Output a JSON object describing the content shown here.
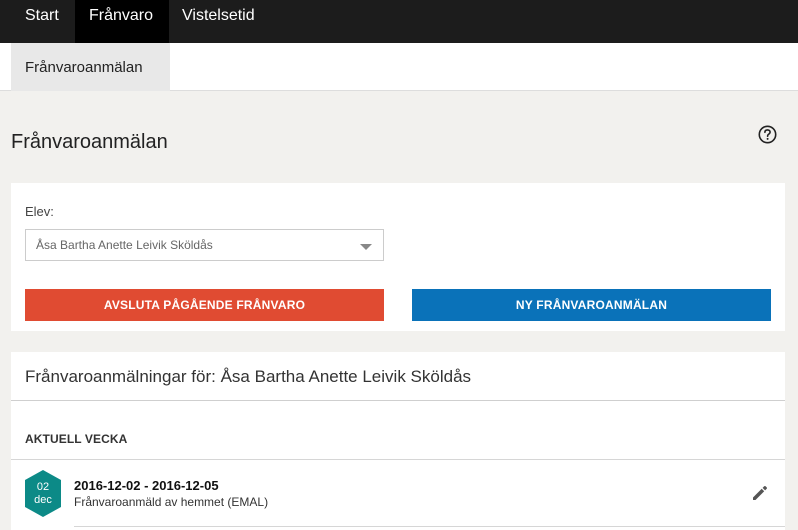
{
  "topnav": {
    "tabs": [
      {
        "label": "Start",
        "active": false
      },
      {
        "label": "Frånvaro",
        "active": true
      },
      {
        "label": "Vistelsetid",
        "active": false
      }
    ]
  },
  "subnav": {
    "active_tab": "Frånvaroanmälan"
  },
  "page": {
    "title": "Frånvaroanmälan",
    "help_icon": "question-circle-icon"
  },
  "form": {
    "student_label": "Elev:",
    "student_selected": "Åsa Bartha Anette Leivik Sköldås",
    "end_absence_button": "AVSLUTA PÅGÅENDE FRÅNVARO",
    "new_report_button": "NY FRÅNVAROANMÄLAN"
  },
  "reports": {
    "title": "Frånvaroanmälningar för: Åsa Bartha Anette Leivik Sköldås",
    "section_label": "AKTUELL VECKA",
    "items": [
      {
        "day": "02",
        "month": "dec",
        "dates": "2016-12-02 - 2016-12-05",
        "description": "Frånvaroanmäld av hemmet (EMAL)",
        "edit_icon": "pencil-icon"
      }
    ]
  },
  "colors": {
    "topnav_bg": "#1c1c1c",
    "danger": "#e04b32",
    "primary": "#0a72b9",
    "date_badge": "#0c8a87"
  }
}
